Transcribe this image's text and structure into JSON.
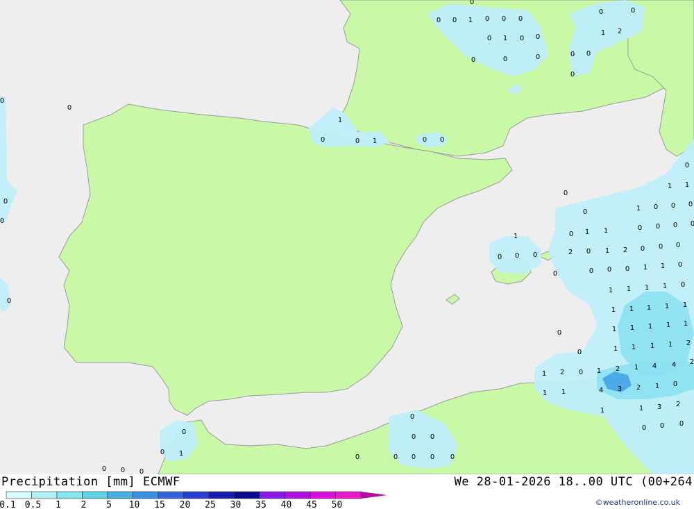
{
  "header": {
    "title": "Precipitation [mm] ECMWF",
    "datetime": "We 28-01-2026 18..00 UTC (00+264"
  },
  "legend": {
    "labels": [
      "0.1",
      "0.5",
      "1",
      "2",
      "5",
      "10",
      "15",
      "20",
      "25",
      "30",
      "35",
      "40",
      "45",
      "50"
    ],
    "colors": [
      "#d7fbff",
      "#aef1f5",
      "#86e6ef",
      "#5fd2e6",
      "#47afe1",
      "#3b8ee0",
      "#3463dc",
      "#263fce",
      "#1a1cae",
      "#0a0a8c",
      "#8a17e6",
      "#b012e0",
      "#d90fe0",
      "#e61cc6",
      "#b30aa6"
    ]
  },
  "credit": "©weatheronline.co.uk",
  "colors": {
    "sea": "#eeeeee",
    "land": "#c9f9a6",
    "border": "#9a9a9a",
    "light_precip": "#bfeefa",
    "medium_precip": "#8ee0f2",
    "heavy_precip": "#4aa6e6"
  },
  "values": [
    "0",
    "0",
    "1",
    "0",
    "0",
    "0",
    "0",
    "0",
    "1",
    "0",
    "0",
    "0",
    "0",
    "0",
    "0",
    "0",
    "0",
    "0",
    "1",
    "2",
    "0",
    "1",
    "0",
    "0",
    "1",
    "0",
    "0",
    "0",
    "0",
    "0",
    "0",
    "0",
    "0",
    "0",
    "1",
    "0",
    "0",
    "0",
    "0",
    "1",
    "1",
    "0",
    "1",
    "1",
    "0",
    "0",
    "0",
    "0",
    "1",
    "0",
    "0",
    "0",
    "0",
    "2",
    "0",
    "1",
    "2",
    "0",
    "0",
    "0",
    "0",
    "0",
    "0",
    "1",
    "1",
    "0",
    "1",
    "1",
    "1",
    "1",
    "0",
    "1",
    "1",
    "1",
    "1",
    "1",
    "1",
    "1",
    "1",
    "1",
    "1",
    "1",
    "1",
    "1",
    "1",
    "2",
    "0",
    "0",
    "1",
    "2",
    "0",
    "1",
    "2",
    "1",
    "4",
    "4",
    "2",
    "4",
    "3",
    "2",
    "1",
    "0",
    "1",
    "1",
    "1",
    "1",
    "3",
    "2",
    "0",
    "0",
    "0",
    "0",
    "0",
    "0",
    "0",
    "0",
    "1",
    "0",
    "0",
    "0",
    "0",
    "0",
    "0",
    "0",
    "0",
    "0",
    "0",
    "0",
    "0",
    "0",
    "0",
    "0",
    "0",
    "1",
    "1",
    "0",
    "0",
    "0"
  ]
}
